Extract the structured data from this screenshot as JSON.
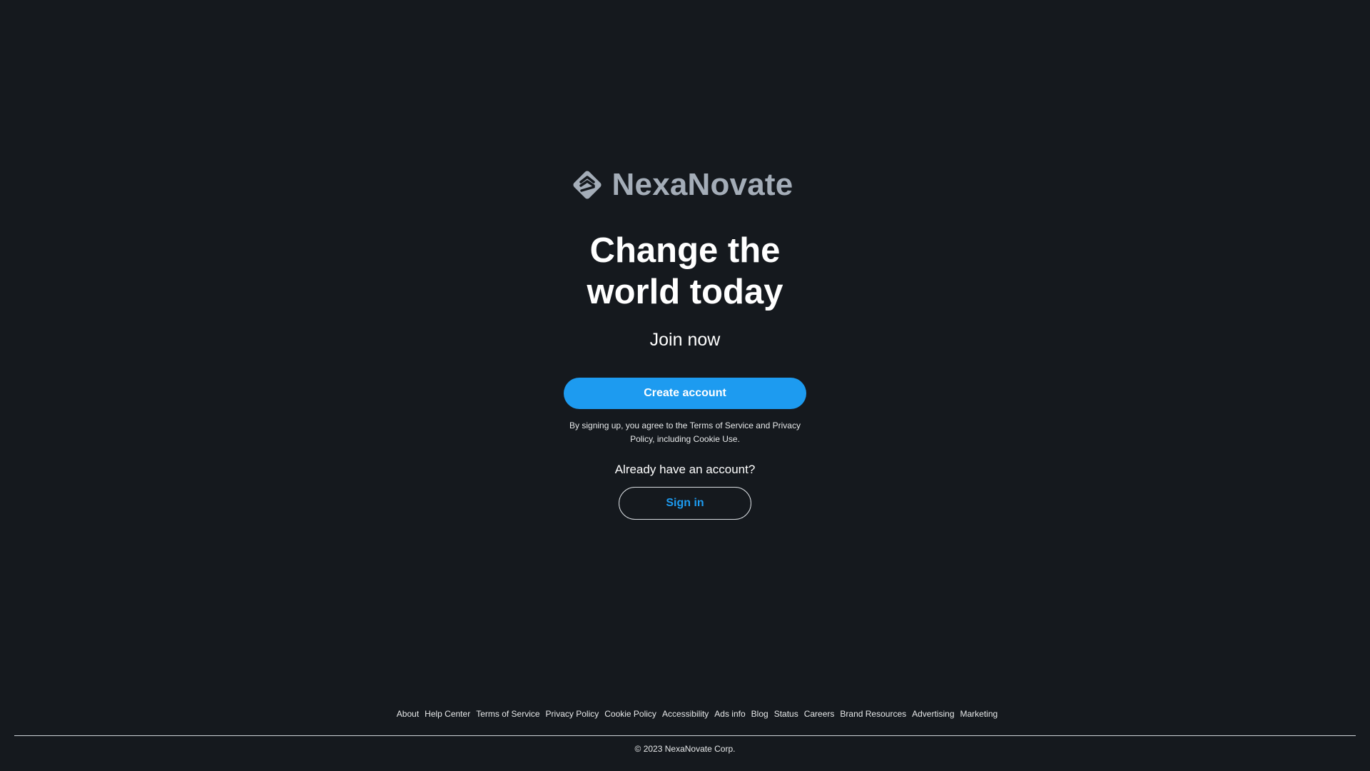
{
  "brand": {
    "name": "NexaNovate",
    "icon": "diamond-chevron-logo-icon",
    "logo_color": "#a4adb8"
  },
  "hero": {
    "headline_line1": "Change the",
    "headline_line2": "world today",
    "subheading": "Join now"
  },
  "signup": {
    "create_account_label": "Create account",
    "terms_text": "By signing up, you agree to the Terms of Service and Privacy Policy, including Cookie Use.",
    "accent_color": "#1d9bf0"
  },
  "signin": {
    "prompt": "Already have an account?",
    "button_label": "Sign in"
  },
  "footer": {
    "links": [
      "About",
      "Help Center",
      "Terms of Service",
      "Privacy Policy",
      "Cookie Policy",
      "Accessibility",
      "Ads info",
      "Blog",
      "Status",
      "Careers",
      "Brand Resources",
      "Advertising",
      "Marketing"
    ],
    "copyright": "© 2023 NexaNovate Corp."
  },
  "colors": {
    "background": "#15191e"
  }
}
